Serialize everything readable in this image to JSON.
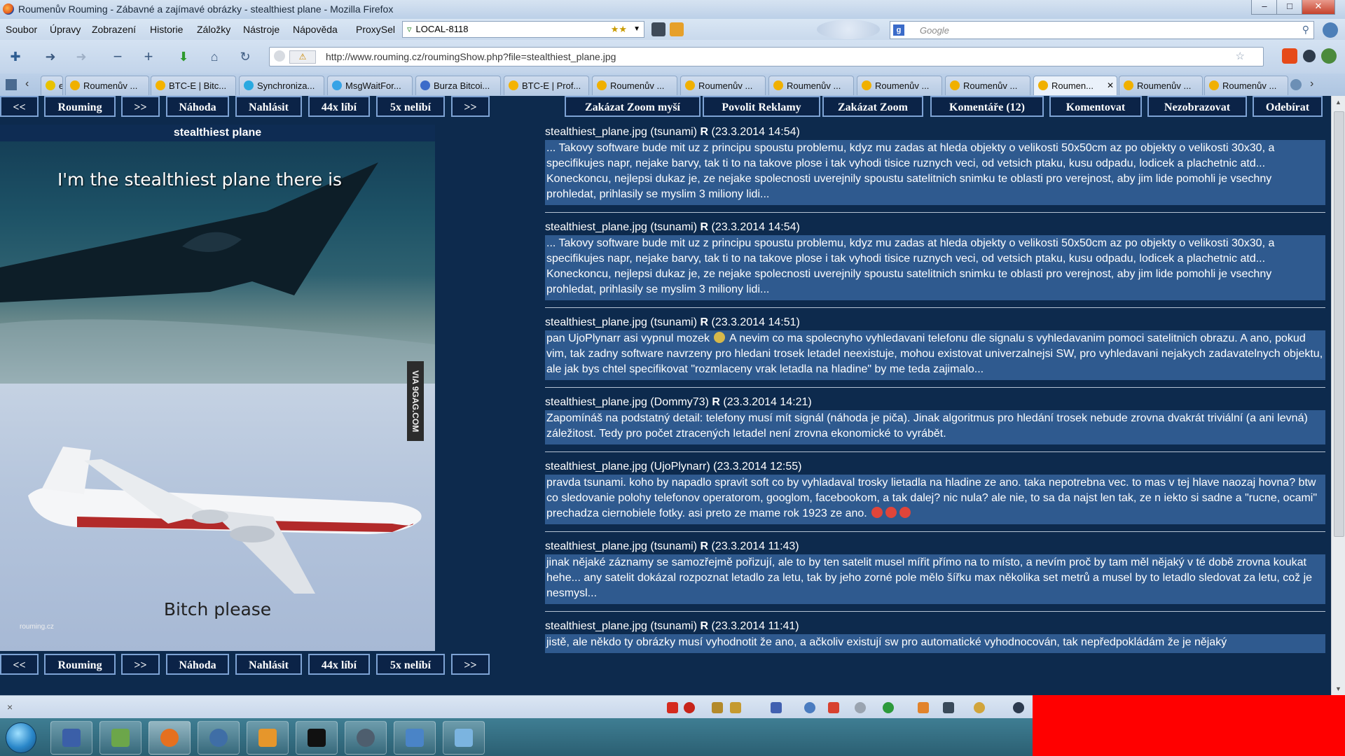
{
  "window": {
    "title": "Roumenův Rouming - Zábavné a zajímavé obrázky - stealthiest plane - Mozilla Firefox",
    "minimize": "–",
    "maximize": "□",
    "close": "✕"
  },
  "menu": {
    "items": [
      "Soubor",
      "Úpravy",
      "Zobrazení",
      "Historie",
      "Záložky",
      "Nástroje",
      "Nápověda",
      "ProxySel"
    ],
    "proxy_value": "LOCAL-8118",
    "search_placeholder": "Google"
  },
  "navbar": {
    "url": "http://www.rouming.cz/roumingShow.php?file=stealthiest_plane.jpg",
    "icons": [
      "new-tab-icon",
      "back-icon",
      "forward-icon",
      "zoom-out-icon",
      "zoom-in-icon",
      "download-icon",
      "home-icon",
      "reload-icon"
    ]
  },
  "tabs": [
    {
      "label": "e ...",
      "color": "#e8c200"
    },
    {
      "label": "Roumenův ...",
      "color": "#f0b000"
    },
    {
      "label": "BTC-E | Bitc...",
      "color": "#f4b300"
    },
    {
      "label": "Synchroniza...",
      "color": "#2aa9e0"
    },
    {
      "label": "MsgWaitFor...",
      "color": "#36a3e6"
    },
    {
      "label": "Burza Bitcoi...",
      "color": "#3b6bc9"
    },
    {
      "label": "BTC-E | Prof...",
      "color": "#f4b300"
    },
    {
      "label": "Roumenův ...",
      "color": "#f0b000"
    },
    {
      "label": "Roumenův ...",
      "color": "#f0b000"
    },
    {
      "label": "Roumenův ...",
      "color": "#f0b000"
    },
    {
      "label": "Roumenův ...",
      "color": "#f0b000"
    },
    {
      "label": "Roumenův ...",
      "color": "#f0b000"
    },
    {
      "label": "Roumen...",
      "color": "#f0b000",
      "active": true
    },
    {
      "label": "Roumenův ...",
      "color": "#f0b000"
    },
    {
      "label": "Roumenův ...",
      "color": "#f0b000"
    }
  ],
  "nav_buttons": {
    "prev": "<<",
    "home": "Rouming",
    "next": ">>",
    "random": "Náhoda",
    "report": "Nahlásit",
    "likes": "44x líbí",
    "dislikes": "5x nelíbí",
    "last": ">>"
  },
  "right_buttons": {
    "disable_zoom_mouse": "Zakázat Zoom myší",
    "allow_ads": "Povolit Reklamy",
    "disable_zoom": "Zakázat Zoom",
    "comments": "Komentáře (12)",
    "comment": "Komentovat",
    "hide": "Nezobrazovat",
    "unsubscribe": "Odebírat"
  },
  "image": {
    "title": "stealthiest plane",
    "caption_top": "I'm the stealthiest plane there is",
    "caption_bottom": "Bitch please",
    "watermark": "VIA 9GAG.COM",
    "credit": "rouming.cz"
  },
  "comments": [
    {
      "file": "stealthiest_plane.jpg",
      "author": "(tsunami)",
      "r": "R",
      "date": "(23.3.2014 14:54)",
      "text": "... Takovy software bude mit uz z principu spoustu problemu, kdyz mu zadas at hleda objekty o velikosti 50x50cm az po objekty o velikosti 30x30, a specifikujes napr, nejake barvy, tak ti to na takove plose i tak vyhodi tisice ruznych veci, od vetsich ptaku, kusu odpadu, lodicek a plachetnic atd... Koneckoncu, nejlepsi dukaz je, ze nejake spolecnosti uverejnily spoustu satelitnich snimku te oblasti pro verejnost, aby jim lide pomohli je vsechny prohledat, prihlasily se myslim 3 miliony lidi..."
    },
    {
      "file": "stealthiest_plane.jpg",
      "author": "(tsunami)",
      "r": "R",
      "date": "(23.3.2014 14:54)",
      "text": "... Takovy software bude mit uz z principu spoustu problemu, kdyz mu zadas at hleda objekty o velikosti 50x50cm az po objekty o velikosti 30x30, a specifikujes napr, nejake barvy, tak ti to na takove plose i tak vyhodi tisice ruznych veci, od vetsich ptaku, kusu odpadu, lodicek a plachetnic atd... Koneckoncu, nejlepsi dukaz je, ze nejake spolecnosti uverejnily spoustu satelitnich snimku te oblasti pro verejnost, aby jim lide pomohli je vsechny prohledat, prihlasily se myslim 3 miliony lidi..."
    },
    {
      "file": "stealthiest_plane.jpg",
      "author": "(tsunami)",
      "r": "R",
      "date": "(23.3.2014 14:51)",
      "text_before": "pan UjoPlynarr asi vypnul mozek ",
      "text": "A nevim co ma spolecnyho vyhledavani telefonu dle signalu s vyhledavanim pomoci satelitnich obrazu. A ano, pokud vim, tak zadny software navrzeny pro hledani trosek letadel neexistuje, mohou existovat univerzalnejsi SW, pro vyhledavani nejakych zadavatelnych objektu, ale jak bys chtel specifikovat \"rozmlaceny vrak letadla na hladine\" by me teda zajimalo..."
    },
    {
      "file": "stealthiest_plane.jpg",
      "author": "(Dommy73)",
      "r": "R",
      "date": "(23.3.2014 14:21)",
      "text": "Zapomínáš na podstatný detail: telefony musí mít signál (náhoda je piča). Jinak algoritmus pro hledání trosek nebude zrovna dvakrát triviální (a ani levná) záležitost. Tedy pro počet ztracených letadel není zrovna ekonomické to vyrábět."
    },
    {
      "file": "stealthiest_plane.jpg",
      "author": "(UjoPlynarr)",
      "r": "",
      "date": "(23.3.2014 12:55)",
      "text": "pravda tsunami. koho by napadlo spravit soft co by vyhladaval trosky lietadla na hladine ze ano. taka nepotrebna vec. to mas v tej hlave naozaj hovna? btw co sledovanie polohy telefonov operatorom, googlom, facebookom, a tak dalej? nic nula? ale nie, to sa da najst len tak, ze n iekto si sadne a \"rucne, ocami\" prechadza ciernobiele fotky. asi preto ze mame rok 1923 ze ano."
    },
    {
      "file": "stealthiest_plane.jpg",
      "author": "(tsunami)",
      "r": "R",
      "date": "(23.3.2014 11:43)",
      "text": "jinak nějaké záznamy se samozřejmě pořizují, ale to by ten satelit musel mířit přímo na to místo, a nevím proč by tam měl nějaký v té době zrovna koukat hehe... any satelit dokázal rozpoznat letadlo za letu, tak by jeho zorné pole mělo šířku max několika set metrů a musel by to letadlo sledovat za letu, což je nesmysl..."
    },
    {
      "file": "stealthiest_plane.jpg",
      "author": "(tsunami)",
      "r": "R",
      "date": "(23.3.2014 11:41)",
      "text": "jistě, ale někdo ty obrázky musí vyhodnotit že ano, a ačkoliv existují sw pro automatické vyhodnocován, tak nepředpokládám že je nějaký"
    }
  ],
  "statusbar": {
    "close": "×"
  },
  "colors": {
    "page_bg": "#0d2a4d",
    "comment_bg": "#2f5a8f",
    "button_border": "#7ea3d4",
    "red_block": "#ff0000"
  }
}
